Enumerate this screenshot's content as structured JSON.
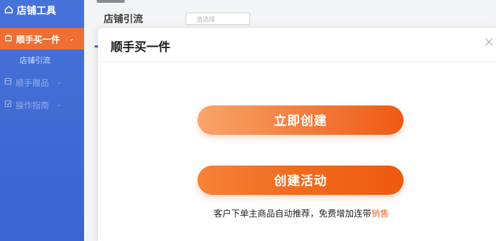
{
  "sidebar": {
    "brand": "店铺工具",
    "active_item": "顺手买一件",
    "sub_item": "店铺引流",
    "items": [
      {
        "label": "顺手赠品"
      },
      {
        "label": "操作指南"
      }
    ]
  },
  "background": {
    "section_title": "店铺引流",
    "input_placeholder": "请选择"
  },
  "modal": {
    "title": "顺手买一件",
    "primary_button": "立即创建",
    "secondary_button": "创建活动",
    "promo_text": "客户下单主商品自动推荐，免费增加连带",
    "promo_highlight": "销售"
  },
  "colors": {
    "sidebar_bg": "#1f4fc8",
    "accent_orange": "#ee5a14",
    "active_nav": "#ec5b17"
  }
}
